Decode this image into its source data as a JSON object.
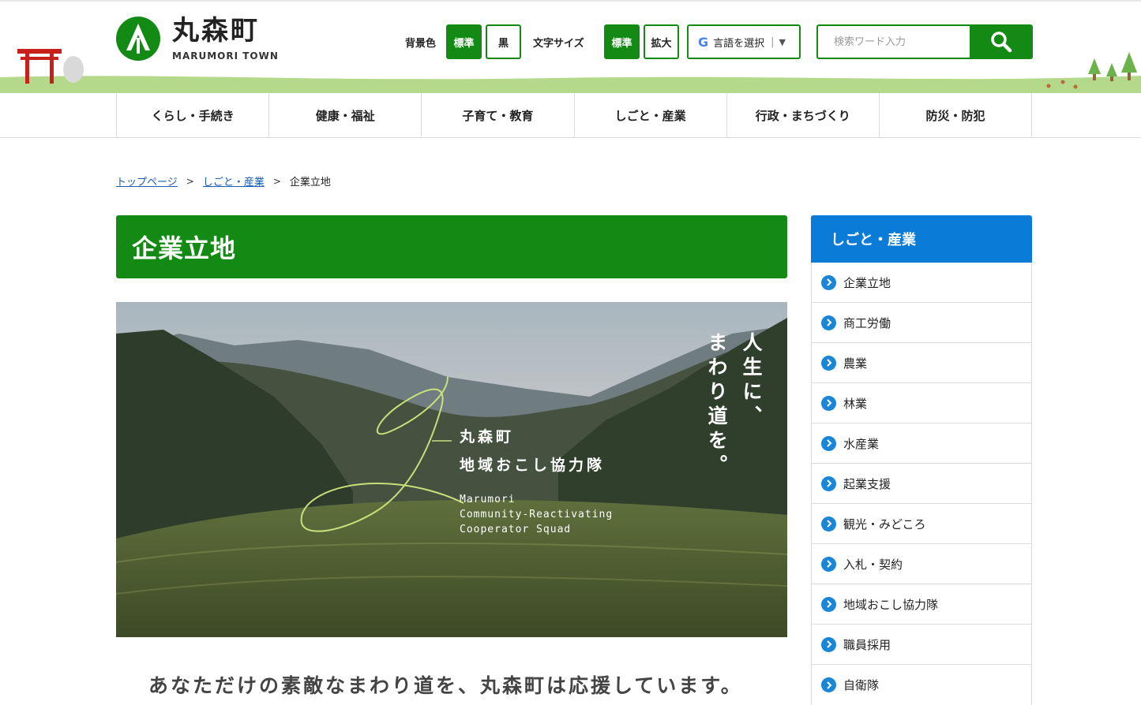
{
  "header": {
    "logo_jp": "丸森町",
    "logo_en": "MARUMORI TOWN",
    "bg_label": "背景色",
    "bg_options": [
      "標準",
      "黒"
    ],
    "font_label": "文字サイズ",
    "font_options": [
      "標準",
      "拡大"
    ],
    "lang_label": "言語を選択",
    "search_placeholder": "検索ワード入力"
  },
  "nav": [
    "くらし・手続き",
    "健康・福祉",
    "子育て・教育",
    "しごと・産業",
    "行政・まちづくり",
    "防災・防犯"
  ],
  "breadcrumb": {
    "home": "トップページ",
    "parent": "しごと・産業",
    "current": "企業立地"
  },
  "main": {
    "title": "企業立地",
    "hero": {
      "title_line1": "丸森町",
      "title_line2": "地域おこし協力隊",
      "en_line1": "Marumori",
      "en_line2": "Community-Reactivating",
      "en_line3": "Cooperator Squad",
      "vertical_right": "人生に、",
      "vertical_left": "まわり道を。"
    },
    "tagline": "あなただけの素敵なまわり道を、丸森町は応援しています。"
  },
  "side": {
    "heading": "しごと・産業",
    "items": [
      "企業立地",
      "商工労働",
      "農業",
      "林業",
      "水産業",
      "起業支援",
      "観光・みどころ",
      "入札・契約",
      "地域おこし協力隊",
      "職員採用",
      "自衛隊"
    ]
  },
  "colors": {
    "green": "#138a13",
    "blue": "#0a7bd6",
    "link": "#1a5fb4"
  }
}
